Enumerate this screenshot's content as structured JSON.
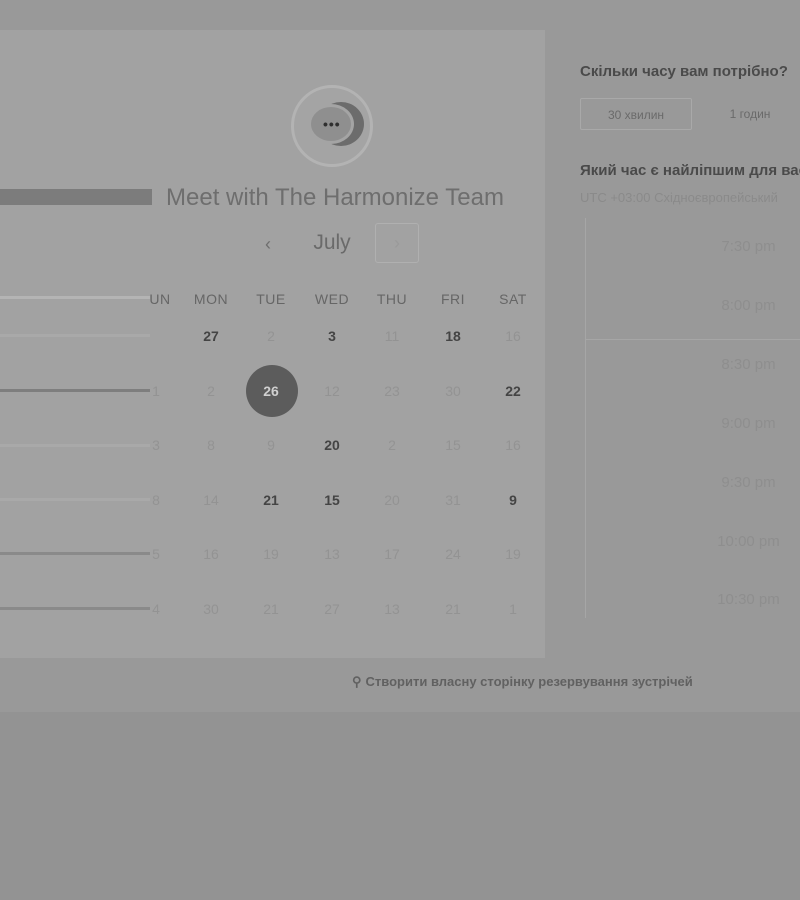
{
  "scheduler": {
    "title": "Meet with The Harmonize Team",
    "month": "July",
    "prev_icon": "chevron-left-icon",
    "next_icon": "chevron-right-icon",
    "prev_glyph": "‹",
    "next_glyph": "›",
    "weekday_partial": "UN",
    "weekdays": [
      "MON",
      "TUE",
      "WED",
      "THU",
      "FRI",
      "SAT"
    ],
    "rows": [
      [
        "27",
        "2",
        "3",
        "11",
        "18",
        "16"
      ],
      [
        "1",
        "2",
        "26",
        "12",
        "23",
        "30",
        "22"
      ],
      [
        "3",
        "8",
        "9",
        "20",
        "2",
        "15",
        "16"
      ],
      [
        "8",
        "14",
        "21",
        "15",
        "20",
        "31",
        "9"
      ],
      [
        "5",
        "16",
        "19",
        "13",
        "17",
        "24",
        "19"
      ],
      [
        "4",
        "30",
        "21",
        "27",
        "13",
        "21",
        "1"
      ]
    ],
    "selected_day": "26"
  },
  "duration": {
    "question": "Скільки часу вам потрібно?",
    "options": [
      "30 хвилин",
      "1 годин"
    ]
  },
  "time": {
    "question": "Який час є найліпшим для вас?",
    "timezone": "UTC +03:00 Східноєвропейський",
    "slots": [
      "7:30 pm",
      "8:00 pm",
      "8:30 pm",
      "9:00 pm",
      "9:30 pm",
      "10:00 pm",
      "10:30 pm"
    ]
  },
  "footer": {
    "link": "Створити власну сторінку резервування зустрічей",
    "icon": "wand-icon",
    "icon_glyph": "⚲"
  }
}
